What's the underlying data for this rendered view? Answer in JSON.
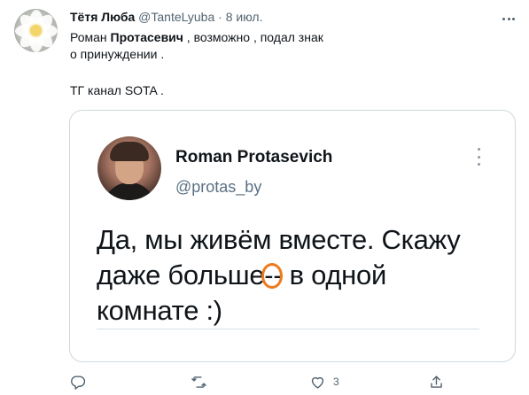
{
  "tweet": {
    "author_name": "Тётя Люба",
    "handle": "@TanteLyuba",
    "separator": "·",
    "date": "8 июл.",
    "text_part1": "Роман ",
    "text_bold": "Протасевич",
    "text_part2": " , возможно , подал знак",
    "text_line2": "о принуждении .",
    "text_line3": "ТГ канал SOTA ."
  },
  "embedded": {
    "name": "Roman Protasevich",
    "handle": "@protas_by",
    "line1": "Да, мы живём вместе. Скажу",
    "line2_start": "даже больше",
    "line2_dash": "--",
    "line2_end": " в одной",
    "line3": "комнате :)",
    "highlight_color": "#ee7a1b"
  },
  "actions": {
    "reply_icon": "reply-icon",
    "retweet_icon": "retweet-icon",
    "like_icon": "heart-icon",
    "like_count": "3",
    "share_icon": "share-icon"
  },
  "colors": {
    "text_primary": "#0f1419",
    "text_secondary": "#536471",
    "border": "#cfd9de"
  }
}
